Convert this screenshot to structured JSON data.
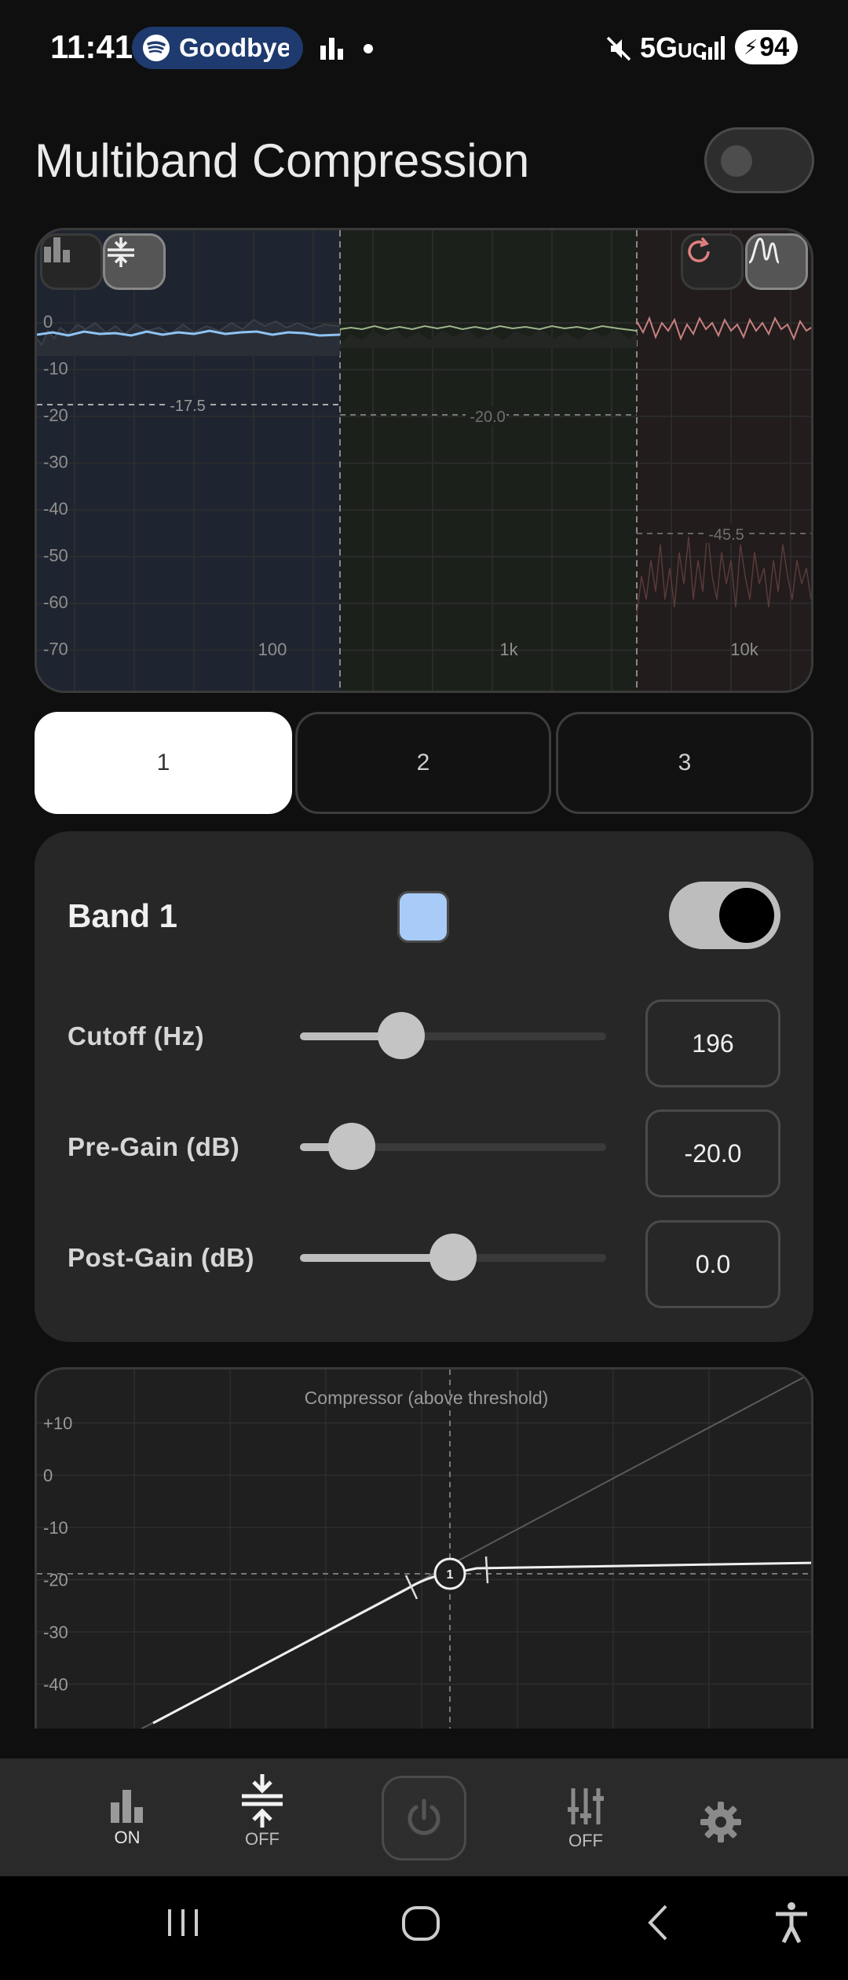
{
  "status_bar": {
    "time": "11:41",
    "now_playing": "Goodbye",
    "network": "5G",
    "network_suffix": "UC",
    "battery": "94",
    "icons": [
      "spotify-icon",
      "equalizer-icon",
      "dot-icon",
      "mute-icon",
      "signal-icon",
      "battery-charging-icon"
    ]
  },
  "header": {
    "title": "Multiband Compression",
    "master_toggle_on": false
  },
  "spectrum": {
    "y_ticks": [
      "0",
      "-10",
      "-20",
      "-30",
      "-40",
      "-50",
      "-60",
      "-70"
    ],
    "x_ticks": [
      "100",
      "1k",
      "10k"
    ],
    "thresholds": [
      "-17.5",
      "-20.0",
      "-45.5"
    ],
    "band_colors": [
      "#8fc3f2",
      "#9db58a",
      "#c98080"
    ],
    "tools_left": [
      "bar-chart-icon",
      "compress-icon"
    ],
    "tools_right": [
      "reset-icon",
      "curve-icon"
    ]
  },
  "band_tabs": [
    "1",
    "2",
    "3"
  ],
  "selected_band": "1",
  "band": {
    "title": "Band 1",
    "color": "#a8ccf7",
    "enabled": true,
    "params": [
      {
        "label": "Cutoff (Hz)",
        "value": "196",
        "level": 0.33
      },
      {
        "label": "Pre-Gain (dB)",
        "value": "-20.0",
        "level": 0.17
      },
      {
        "label": "Post-Gain (dB)",
        "value": "0.0",
        "level": 0.5
      }
    ]
  },
  "compressor": {
    "title": "Compressor (above threshold)",
    "y_ticks": [
      "+10",
      "0",
      "-10",
      "-20",
      "-30",
      "-40"
    ],
    "node_label": "1"
  },
  "bottom_nav": {
    "items": [
      {
        "icon": "bar-chart-icon",
        "label": "ON"
      },
      {
        "icon": "compress-icon",
        "label": "OFF"
      },
      {
        "icon": "power-icon",
        "label": ""
      },
      {
        "icon": "sliders-icon",
        "label": "OFF"
      },
      {
        "icon": "gear-icon",
        "label": ""
      }
    ]
  }
}
